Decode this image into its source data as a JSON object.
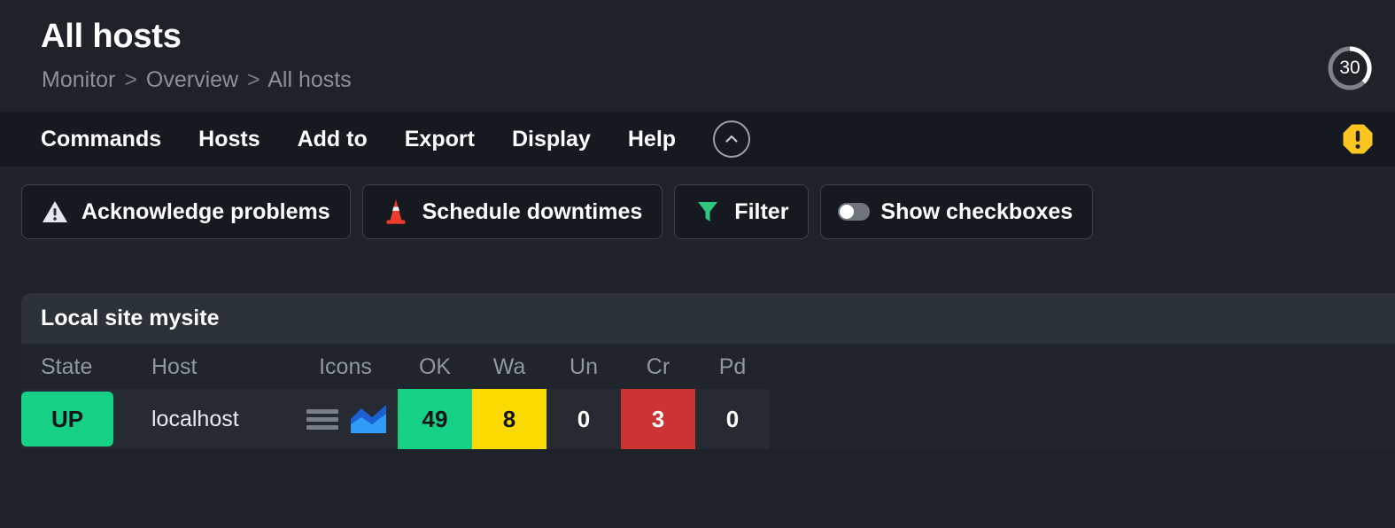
{
  "header": {
    "title": "All hosts",
    "breadcrumb": [
      "Monitor",
      "Overview",
      "All hosts"
    ],
    "breadcrumb_separator": ">",
    "refresh": {
      "seconds": "30",
      "icon": "refresh-countdown-ring",
      "ring_track_color": "#7c838c",
      "ring_progress_color": "#ffffff"
    }
  },
  "menu": {
    "items": [
      {
        "label": "Commands",
        "name": "menu-item-commands"
      },
      {
        "label": "Hosts",
        "name": "menu-item-hosts"
      },
      {
        "label": "Add to",
        "name": "menu-item-add-to"
      },
      {
        "label": "Export",
        "name": "menu-item-export"
      },
      {
        "label": "Display",
        "name": "menu-item-display"
      },
      {
        "label": "Help",
        "name": "menu-item-help"
      }
    ],
    "collapse_icon": "chevron-up-icon",
    "alert_icon": "warning-octagon-icon",
    "alert_color": "#fcc520"
  },
  "actions": [
    {
      "label": "Acknowledge problems",
      "icon": "warning-triangle-icon",
      "icon_color": "#e6e6f0"
    },
    {
      "label": "Schedule downtimes",
      "icon": "traffic-cone-icon",
      "icon_color": "#ef3b2d"
    },
    {
      "label": "Filter",
      "icon": "funnel-icon",
      "icon_color": "#2cc97f"
    },
    {
      "label": "Show checkboxes",
      "icon": "toggle-switch-off-icon",
      "icon_color": "#6f757d"
    }
  ],
  "panel": {
    "title": "Local site mysite",
    "columns": [
      {
        "key": "state",
        "label": "State"
      },
      {
        "key": "host",
        "label": "Host"
      },
      {
        "key": "icons",
        "label": "Icons"
      },
      {
        "key": "ok",
        "label": "OK"
      },
      {
        "key": "wa",
        "label": "Wa"
      },
      {
        "key": "un",
        "label": "Un"
      },
      {
        "key": "cr",
        "label": "Cr"
      },
      {
        "key": "pd",
        "label": "Pd"
      }
    ],
    "rows": [
      {
        "state": "UP",
        "state_color": "#15d085",
        "host": "localhost",
        "icons": [
          "hamburger-menu-icon",
          "area-chart-icon"
        ],
        "ok": "49",
        "wa": "8",
        "un": "0",
        "cr": "3",
        "pd": "0"
      }
    ]
  },
  "colors": {
    "page_background": "#1f2329",
    "menu_background": "#151a21",
    "panel_header": "#2b3139",
    "panel_body": "#20242b",
    "row_cell": "#262b33",
    "ok_green": "#15d085",
    "warn_yellow": "#fcd900",
    "crit_red": "#cc3434"
  }
}
